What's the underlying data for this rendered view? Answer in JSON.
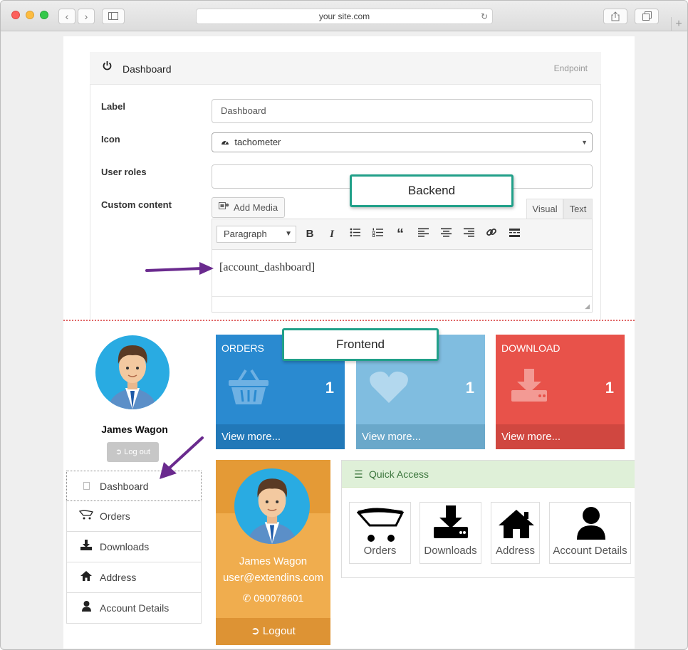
{
  "browser": {
    "url": "your site.com"
  },
  "backend": {
    "panel_title": "Dashboard",
    "endpoint_label": "Endpoint",
    "fields": {
      "label_label": "Label",
      "label_value": "Dashboard",
      "icon_label": "Icon",
      "icon_value": "tachometer",
      "roles_label": "User roles",
      "roles_value": "",
      "content_label": "Custom content"
    },
    "editor": {
      "add_media": "Add Media",
      "tab_visual": "Visual",
      "tab_text": "Text",
      "format": "Paragraph",
      "content": "[account_dashboard]"
    }
  },
  "callouts": {
    "backend": "Backend",
    "frontend": "Frontend"
  },
  "frontend": {
    "user_name": "James Wagon",
    "logout_small": "Log out",
    "menu": [
      {
        "label": "Dashboard",
        "icon": "square-icon"
      },
      {
        "label": "Orders",
        "icon": "cart-icon"
      },
      {
        "label": "Downloads",
        "icon": "download-icon"
      },
      {
        "label": "Address",
        "icon": "home-icon"
      },
      {
        "label": "Account Details",
        "icon": "user-icon"
      }
    ],
    "tiles": [
      {
        "title": "ORDERS",
        "count": "1",
        "footer": "View more...",
        "color": "#2a8ad0"
      },
      {
        "title": "",
        "count": "1",
        "footer": "View more...",
        "color": "#80bde0"
      },
      {
        "title": "DOWNLOAD",
        "count": "1",
        "footer": "View more...",
        "color": "#e8524a"
      }
    ],
    "profile": {
      "name": "James Wagon",
      "email": "user@extendins.com",
      "phone": "090078601",
      "logout": "Logout"
    },
    "quick_access": {
      "title": "Quick Access",
      "items": [
        {
          "label": "Orders",
          "icon": "cart-icon"
        },
        {
          "label": "Downloads",
          "icon": "download-icon"
        },
        {
          "label": "Address",
          "icon": "home-icon"
        },
        {
          "label": "Account Details",
          "icon": "user-icon"
        }
      ]
    }
  }
}
